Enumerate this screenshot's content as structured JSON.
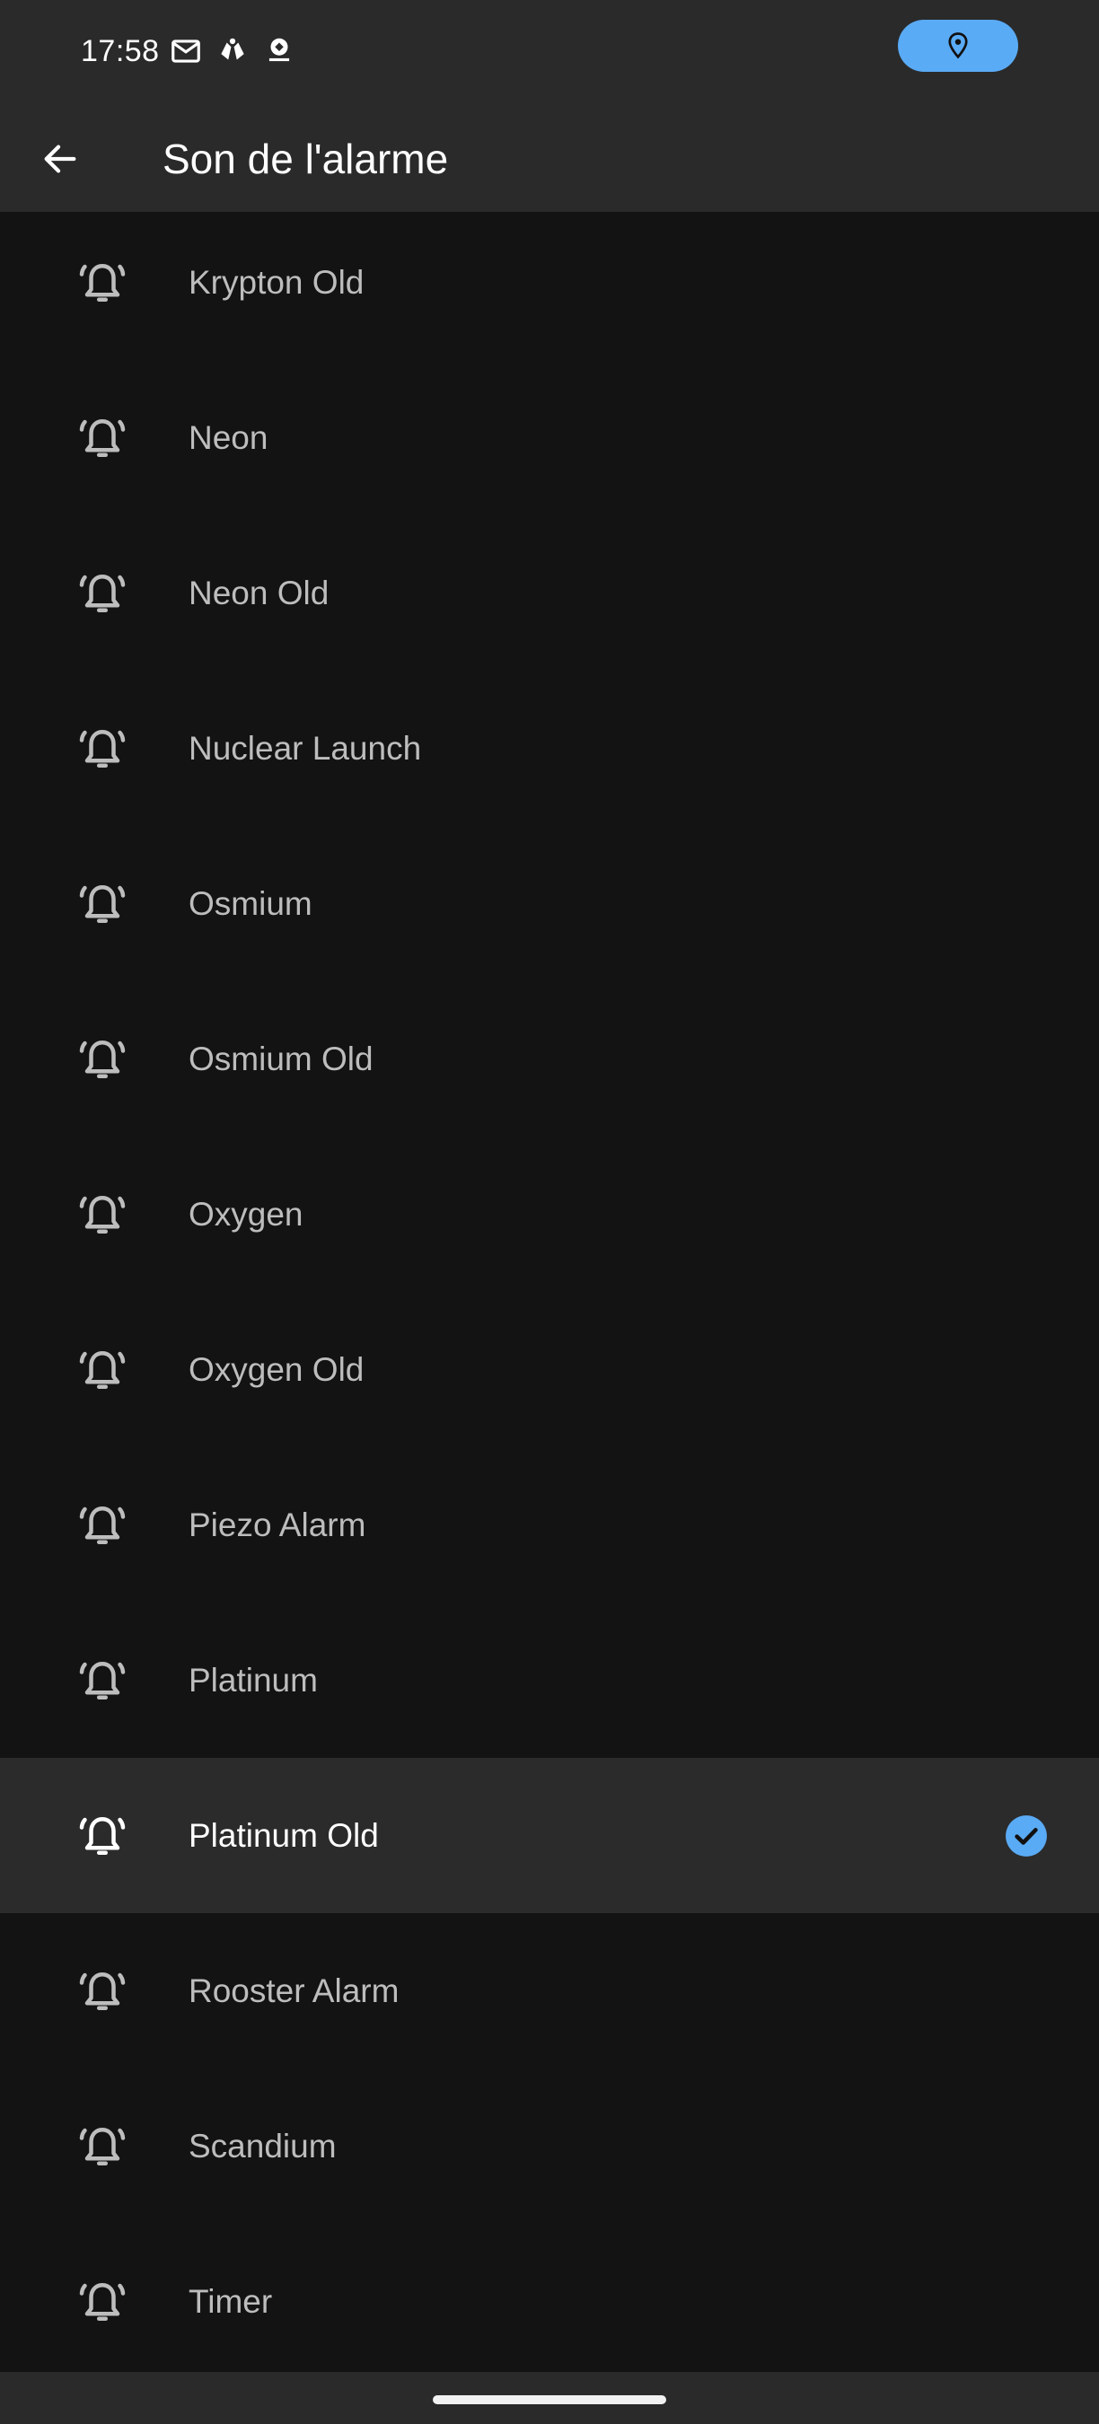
{
  "status_bar": {
    "time": "17:58",
    "icons": [
      "mail-icon",
      "hands-icon",
      "bouygues-icon"
    ],
    "location_icon": "location-pin-icon",
    "accent_color": "#5aabf5"
  },
  "app_bar": {
    "back_icon": "arrow-left-icon",
    "title": "Son de l'alarme"
  },
  "list": {
    "item_icon": "alarm-bell-icon",
    "selected_icon": "check-circle-icon",
    "items": [
      {
        "label": "Krypton Old",
        "selected": false
      },
      {
        "label": "Neon",
        "selected": false
      },
      {
        "label": "Neon Old",
        "selected": false
      },
      {
        "label": "Nuclear Launch",
        "selected": false
      },
      {
        "label": "Osmium",
        "selected": false
      },
      {
        "label": "Osmium Old",
        "selected": false
      },
      {
        "label": "Oxygen",
        "selected": false
      },
      {
        "label": "Oxygen Old",
        "selected": false
      },
      {
        "label": "Piezo Alarm",
        "selected": false
      },
      {
        "label": "Platinum",
        "selected": false
      },
      {
        "label": "Platinum Old",
        "selected": true
      },
      {
        "label": "Rooster Alarm",
        "selected": false
      },
      {
        "label": "Scandium",
        "selected": false
      },
      {
        "label": "Timer",
        "selected": false
      }
    ]
  },
  "colors": {
    "background": "#131313",
    "bar_background": "#2a2a2a",
    "selected_row": "#2b2b2b",
    "check_color": "#5aabf5"
  }
}
